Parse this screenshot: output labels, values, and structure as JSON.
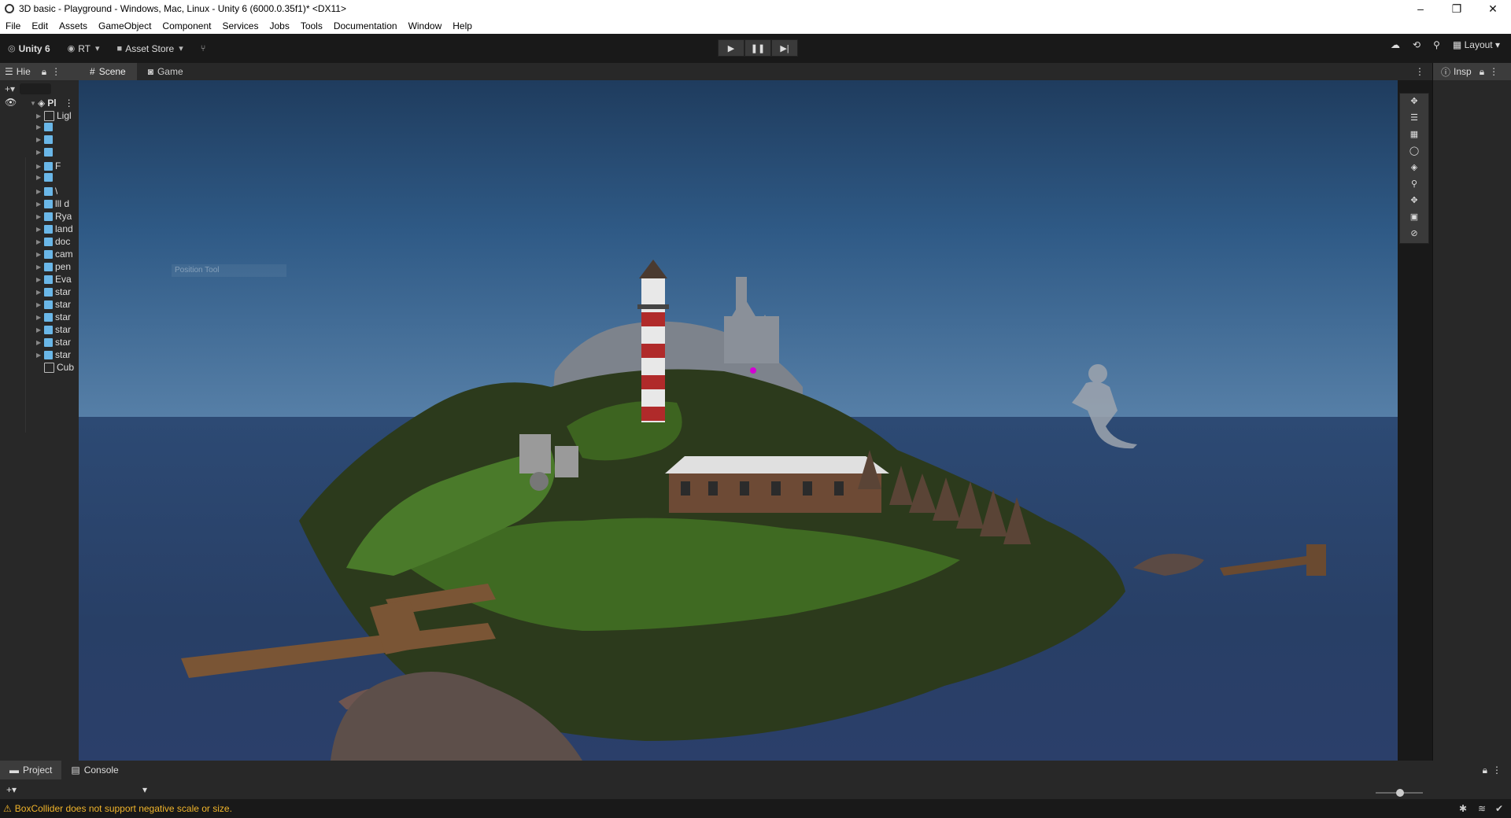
{
  "window": {
    "title": "3D basic - Playground - Windows, Mac, Linux - Unity 6 (6000.0.35f1)* <DX11>",
    "controls": [
      "–",
      "❐",
      "✕"
    ]
  },
  "menu": [
    "File",
    "Edit",
    "Assets",
    "GameObject",
    "Component",
    "Services",
    "Jobs",
    "Tools",
    "Documentation",
    "Window",
    "Help"
  ],
  "toolbar": {
    "account_label": "Unity 6",
    "user_label": "RT",
    "asset_store_label": "Asset Store",
    "layout_label": "Layout"
  },
  "hierarchy": {
    "tab_label": "Hie",
    "root": "Pl",
    "items": [
      "Ligl",
      "",
      "",
      "",
      "F",
      "",
      "\\",
      "lll d",
      "Rya",
      "land",
      "doc",
      "cam",
      "pen",
      "Eva",
      "star",
      "star",
      "star",
      "star",
      "star",
      "star",
      "Cub"
    ]
  },
  "scene": {
    "tabs": [
      "Scene",
      "Game"
    ],
    "ghost_text": "Position Tool"
  },
  "inspector": {
    "tab_label": "Insp"
  },
  "bottom": {
    "tabs": [
      "Project",
      "Console"
    ]
  },
  "status": {
    "message": "BoxCollider does not support negative scale or size."
  },
  "colors": {
    "sky_top": "#1f3c5e",
    "sea": "#283f66",
    "island": "#3a4a22",
    "warning": "#f0b42b"
  }
}
